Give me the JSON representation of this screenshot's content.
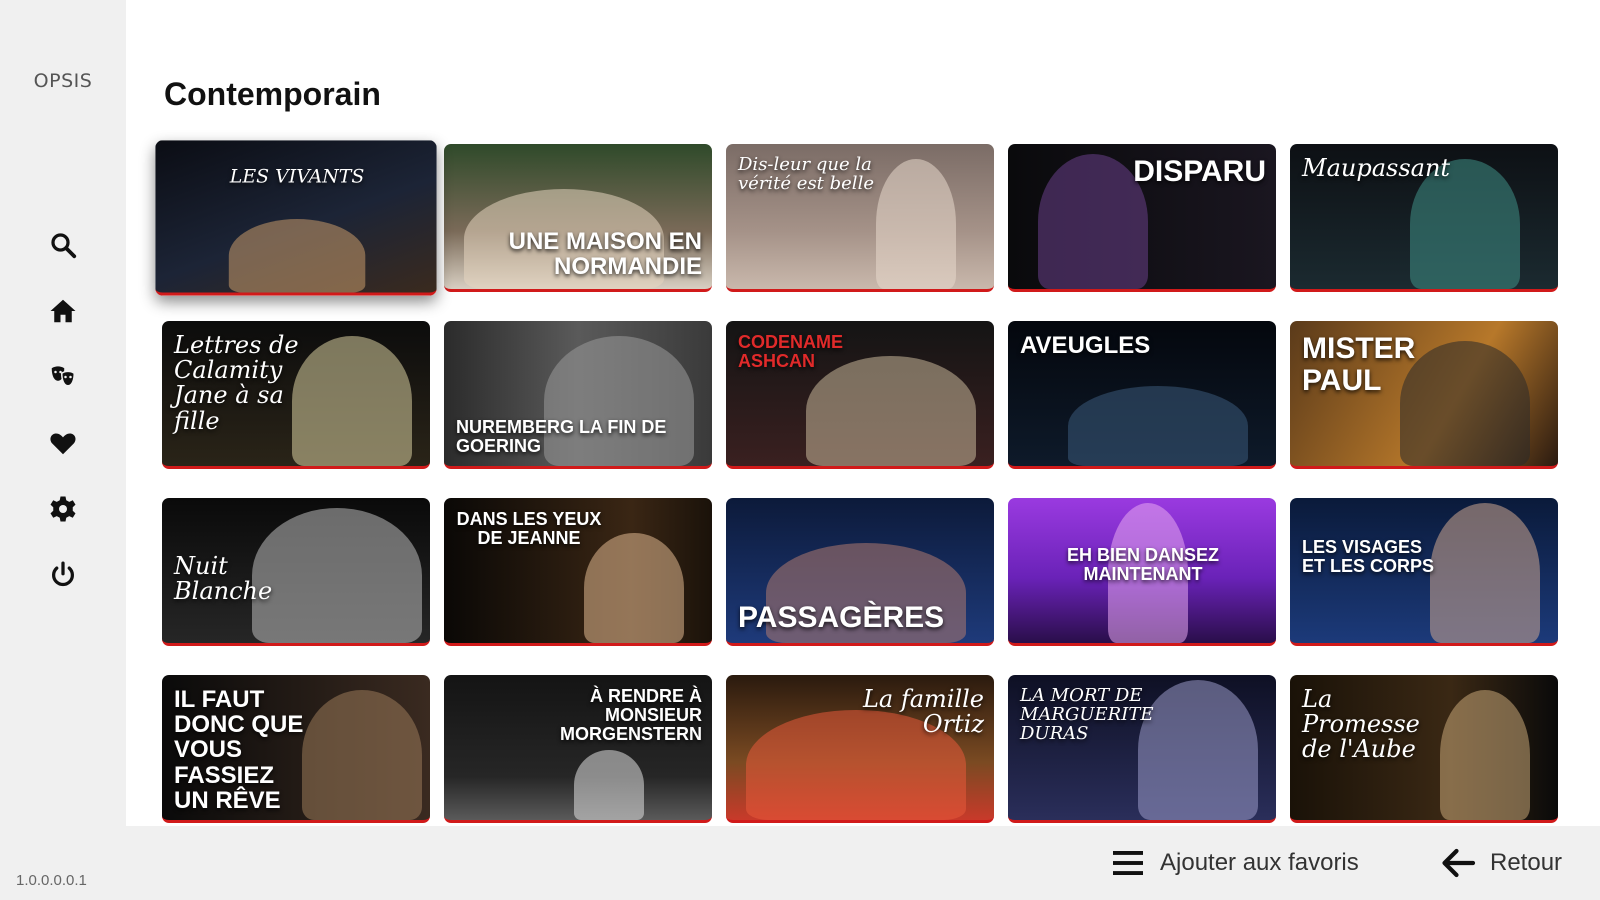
{
  "app": {
    "logo": "OPSIS",
    "version": "1.0.0.0.0.1"
  },
  "sidebar": {
    "items": [
      {
        "name": "search",
        "icon": "search-icon"
      },
      {
        "name": "home",
        "icon": "home-icon"
      },
      {
        "name": "theater",
        "icon": "theater-masks-icon"
      },
      {
        "name": "favorites",
        "icon": "heart-icon"
      },
      {
        "name": "settings",
        "icon": "gear-icon"
      },
      {
        "name": "power",
        "icon": "power-icon"
      }
    ]
  },
  "main": {
    "title": "Contemporain",
    "cards": [
      {
        "title": "LES VIVANTS",
        "bg": "linear-gradient(160deg,#0b0d14 0%,#1c2436 55%,#3a2a1e 100%)",
        "fig": "#c89a6a"
      },
      {
        "title": "UNE MAISON EN NORMANDIE",
        "bg": "linear-gradient(180deg,#2f4a2a 0%,#7a6a58 60%,#d8cfc2 100%)",
        "fig": "#e6d6c0"
      },
      {
        "title": "Dis-leur que la vérité est belle",
        "bg": "linear-gradient(180deg,#7b6c66 0%,#a59288 60%,#c9b8ac 100%)",
        "fig": "#e8d8cc"
      },
      {
        "title": "DISPARU",
        "bg": "linear-gradient(90deg,#0a0a0c 0%,#1a1620 100%)",
        "fig": "#6a3f8a"
      },
      {
        "title": "Maupassant",
        "bg": "linear-gradient(180deg,#0d1014 0%,#1b2a30 100%)",
        "fig": "#3f8f86"
      },
      {
        "title": "Lettres de Calamity Jane à sa fille",
        "bg": "linear-gradient(180deg,#0c0c0c 0%,#2a2418 100%)",
        "fig": "#d9cfa0"
      },
      {
        "title": "NUREMBERG LA FIN DE GOERING",
        "bg": "linear-gradient(90deg,#2b2b2b 0%,#5a5a5a 50%,#3a3a3a 100%)",
        "fig": "#9a9a9a"
      },
      {
        "title": "CODENAME ASHCAN",
        "bg": "linear-gradient(180deg,#141414 0%,#3a2020 100%)",
        "fig": "#c8b89a"
      },
      {
        "title": "AVEUGLES",
        "bg": "linear-gradient(180deg,#04070d 0%,#0e1a2a 100%)",
        "fig": "#3a5a7a"
      },
      {
        "title": "MISTER PAUL",
        "bg": "linear-gradient(120deg,#5a3a1a 0%,#b7782a 60%,#2a1a10 100%)",
        "fig": "#2a2a2a"
      },
      {
        "title": "Nuit Blanche",
        "bg": "linear-gradient(180deg,#0a0a0a 0%,#262626 100%)",
        "fig": "#bcbcbc"
      },
      {
        "title": "DANS LES YEUX DE JEANNE",
        "bg": "linear-gradient(90deg,#0a0806 0%,#3a2614 70%,#1a120a 100%)",
        "fig": "#e0b890"
      },
      {
        "title": "PASSAGÈRES",
        "bg": "linear-gradient(180deg,#0c1a3a 0%,#1e3a7a 100%)",
        "fig": "#b07a70"
      },
      {
        "title": "EH BIEN DANSEZ MAINTENANT",
        "bg": "linear-gradient(180deg,#9a3ae0 0%,#6a22b8 55%,#2a0e4a 100%)",
        "fig": "#e8a8f0"
      },
      {
        "title": "LES VISAGES ET LES CORPS",
        "bg": "linear-gradient(180deg,#0a1a3a 0%,#1c3a7a 100%)",
        "fig": "#d0a890"
      },
      {
        "title": "IL FAUT DONC QUE VOUS FASSIEZ UN RÊVE",
        "bg": "linear-gradient(90deg,#0a0a0a 0%,#3a2a20 100%)",
        "fig": "#9a7a5a"
      },
      {
        "title": "À RENDRE À MONSIEUR MORGENSTERN",
        "bg": "linear-gradient(180deg,#141414 0%,#262626 70%,#5a5a5a 100%)",
        "fig": "#e0e0e0"
      },
      {
        "title": "La famille Ortiz",
        "bg": "linear-gradient(180deg,#2a1a0e 0%,#7a4a22 60%,#c83a2a 100%)",
        "fig": "#e85a3a"
      },
      {
        "title": "LA MORT DE MARGUERITE DURAS",
        "bg": "linear-gradient(180deg,#0e1024 0%,#2a2e5a 100%)",
        "fig": "#9a9ac8"
      },
      {
        "title": "La Promesse de l'Aube",
        "bg": "linear-gradient(90deg,#1a1208 0%,#3a2814 60%,#0a0a0a 100%)",
        "fig": "#c8a878"
      }
    ]
  },
  "bottom": {
    "favorites_label": "Ajouter aux favoris",
    "back_label": "Retour"
  },
  "colors": {
    "accent": "#d11a1a",
    "sidebar_bg": "#f0f0f0",
    "content_bg": "#ffffff"
  }
}
